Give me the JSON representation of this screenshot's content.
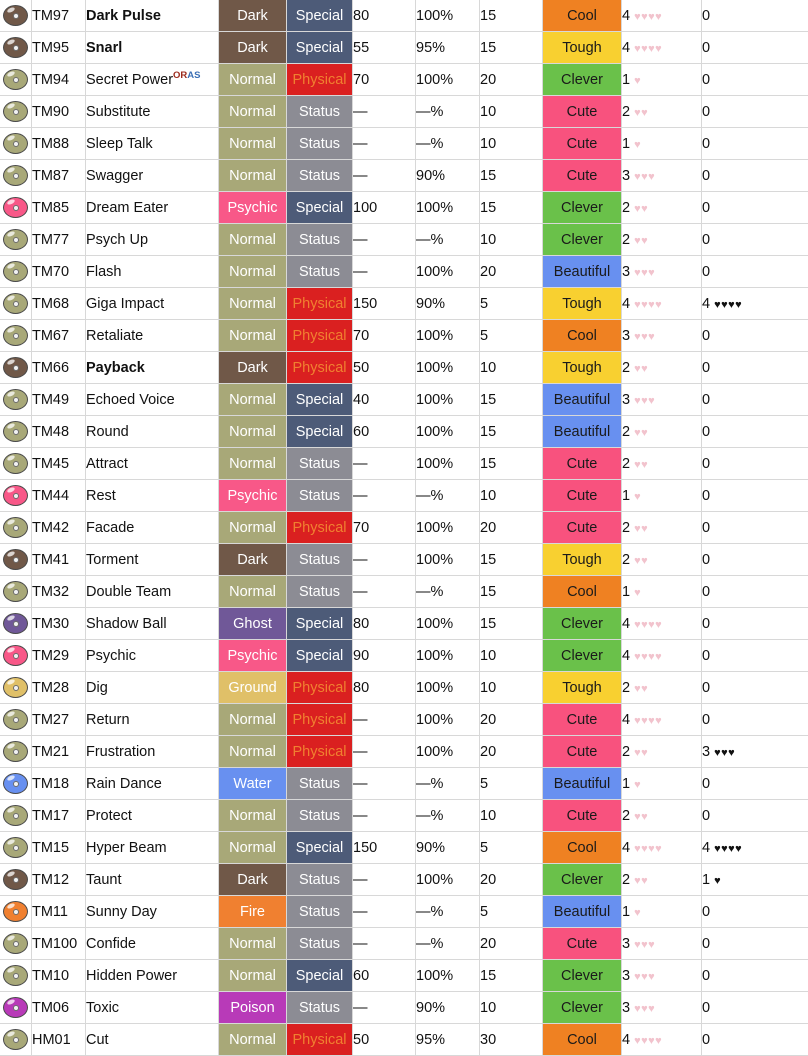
{
  "table": {
    "columns": [
      "icon",
      "number",
      "name",
      "type",
      "category",
      "power",
      "accuracy",
      "pp",
      "contest",
      "appeal",
      "jam"
    ],
    "type_colors": {
      "Dark": "#705848",
      "Normal": "#a8a878",
      "Psychic": "#f85888",
      "Ghost": "#705898",
      "Ground": "#e0c068",
      "Water": "#6890f0",
      "Fire": "#f08030",
      "Poison": "#b83ab8"
    },
    "category_colors": {
      "Physical": "#da2020",
      "Special": "#4d5b78",
      "Status": "#8c8c94"
    },
    "category_text_colors": {
      "Physical": "#f08030",
      "Special": "#ffffff",
      "Status": "#ffffff"
    },
    "contest_colors": {
      "Cool": "#ef8122",
      "Tough": "#f8d030",
      "Clever": "#6ac14a",
      "Cute": "#f8527e",
      "Beautiful": "#6890f0"
    },
    "rows": [
      {
        "number": "TM97",
        "name": "Dark Pulse",
        "bold": true,
        "type": "Dark",
        "category": "Special",
        "power": "80",
        "accuracy": "100%",
        "pp": "15",
        "contest": "Cool",
        "appeal": "4",
        "appeal_hearts": 4,
        "jam": "0",
        "jam_hearts": 0
      },
      {
        "number": "TM95",
        "name": "Snarl",
        "bold": true,
        "type": "Dark",
        "category": "Special",
        "power": "55",
        "accuracy": "95%",
        "pp": "15",
        "contest": "Tough",
        "appeal": "4",
        "appeal_hearts": 4,
        "jam": "0",
        "jam_hearts": 0
      },
      {
        "number": "TM94",
        "name": "Secret Power",
        "bold": false,
        "sup": "ORAS",
        "type": "Normal",
        "category": "Physical",
        "power": "70",
        "accuracy": "100%",
        "pp": "20",
        "contest": "Clever",
        "appeal": "1",
        "appeal_hearts": 1,
        "jam": "0",
        "jam_hearts": 0
      },
      {
        "number": "TM90",
        "name": "Substitute",
        "bold": false,
        "type": "Normal",
        "category": "Status",
        "power": "—",
        "accuracy": "—%",
        "pp": "10",
        "contest": "Cute",
        "appeal": "2",
        "appeal_hearts": 2,
        "jam": "0",
        "jam_hearts": 0
      },
      {
        "number": "TM88",
        "name": "Sleep Talk",
        "bold": false,
        "type": "Normal",
        "category": "Status",
        "power": "—",
        "accuracy": "—%",
        "pp": "10",
        "contest": "Cute",
        "appeal": "1",
        "appeal_hearts": 1,
        "jam": "0",
        "jam_hearts": 0
      },
      {
        "number": "TM87",
        "name": "Swagger",
        "bold": false,
        "type": "Normal",
        "category": "Status",
        "power": "—",
        "accuracy": "90%",
        "pp": "15",
        "contest": "Cute",
        "appeal": "3",
        "appeal_hearts": 3,
        "jam": "0",
        "jam_hearts": 0
      },
      {
        "number": "TM85",
        "name": "Dream Eater",
        "bold": false,
        "type": "Psychic",
        "category": "Special",
        "power": "100",
        "accuracy": "100%",
        "pp": "15",
        "contest": "Clever",
        "appeal": "2",
        "appeal_hearts": 2,
        "jam": "0",
        "jam_hearts": 0
      },
      {
        "number": "TM77",
        "name": "Psych Up",
        "bold": false,
        "type": "Normal",
        "category": "Status",
        "power": "—",
        "accuracy": "—%",
        "pp": "10",
        "contest": "Clever",
        "appeal": "2",
        "appeal_hearts": 2,
        "jam": "0",
        "jam_hearts": 0
      },
      {
        "number": "TM70",
        "name": "Flash",
        "bold": false,
        "type": "Normal",
        "category": "Status",
        "power": "—",
        "accuracy": "100%",
        "pp": "20",
        "contest": "Beautiful",
        "appeal": "3",
        "appeal_hearts": 3,
        "jam": "0",
        "jam_hearts": 0
      },
      {
        "number": "TM68",
        "name": "Giga Impact",
        "bold": false,
        "type": "Normal",
        "category": "Physical",
        "power": "150",
        "accuracy": "90%",
        "pp": "5",
        "contest": "Tough",
        "appeal": "4",
        "appeal_hearts": 4,
        "jam": "4",
        "jam_hearts": 4
      },
      {
        "number": "TM67",
        "name": "Retaliate",
        "bold": false,
        "type": "Normal",
        "category": "Physical",
        "power": "70",
        "accuracy": "100%",
        "pp": "5",
        "contest": "Cool",
        "appeal": "3",
        "appeal_hearts": 3,
        "jam": "0",
        "jam_hearts": 0
      },
      {
        "number": "TM66",
        "name": "Payback",
        "bold": true,
        "type": "Dark",
        "category": "Physical",
        "power": "50",
        "accuracy": "100%",
        "pp": "10",
        "contest": "Tough",
        "appeal": "2",
        "appeal_hearts": 2,
        "jam": "0",
        "jam_hearts": 0
      },
      {
        "number": "TM49",
        "name": "Echoed Voice",
        "bold": false,
        "type": "Normal",
        "category": "Special",
        "power": "40",
        "accuracy": "100%",
        "pp": "15",
        "contest": "Beautiful",
        "appeal": "3",
        "appeal_hearts": 3,
        "jam": "0",
        "jam_hearts": 0
      },
      {
        "number": "TM48",
        "name": "Round",
        "bold": false,
        "type": "Normal",
        "category": "Special",
        "power": "60",
        "accuracy": "100%",
        "pp": "15",
        "contest": "Beautiful",
        "appeal": "2",
        "appeal_hearts": 2,
        "jam": "0",
        "jam_hearts": 0
      },
      {
        "number": "TM45",
        "name": "Attract",
        "bold": false,
        "type": "Normal",
        "category": "Status",
        "power": "—",
        "accuracy": "100%",
        "pp": "15",
        "contest": "Cute",
        "appeal": "2",
        "appeal_hearts": 2,
        "jam": "0",
        "jam_hearts": 0
      },
      {
        "number": "TM44",
        "name": "Rest",
        "bold": false,
        "type": "Psychic",
        "category": "Status",
        "power": "—",
        "accuracy": "—%",
        "pp": "10",
        "contest": "Cute",
        "appeal": "1",
        "appeal_hearts": 1,
        "jam": "0",
        "jam_hearts": 0
      },
      {
        "number": "TM42",
        "name": "Facade",
        "bold": false,
        "type": "Normal",
        "category": "Physical",
        "power": "70",
        "accuracy": "100%",
        "pp": "20",
        "contest": "Cute",
        "appeal": "2",
        "appeal_hearts": 2,
        "jam": "0",
        "jam_hearts": 0
      },
      {
        "number": "TM41",
        "name": "Torment",
        "bold": false,
        "type": "Dark",
        "category": "Status",
        "power": "—",
        "accuracy": "100%",
        "pp": "15",
        "contest": "Tough",
        "appeal": "2",
        "appeal_hearts": 2,
        "jam": "0",
        "jam_hearts": 0
      },
      {
        "number": "TM32",
        "name": "Double Team",
        "bold": false,
        "type": "Normal",
        "category": "Status",
        "power": "—",
        "accuracy": "—%",
        "pp": "15",
        "contest": "Cool",
        "appeal": "1",
        "appeal_hearts": 1,
        "jam": "0",
        "jam_hearts": 0
      },
      {
        "number": "TM30",
        "name": "Shadow Ball",
        "bold": false,
        "type": "Ghost",
        "category": "Special",
        "power": "80",
        "accuracy": "100%",
        "pp": "15",
        "contest": "Clever",
        "appeal": "4",
        "appeal_hearts": 4,
        "jam": "0",
        "jam_hearts": 0
      },
      {
        "number": "TM29",
        "name": "Psychic",
        "bold": false,
        "type": "Psychic",
        "category": "Special",
        "power": "90",
        "accuracy": "100%",
        "pp": "10",
        "contest": "Clever",
        "appeal": "4",
        "appeal_hearts": 4,
        "jam": "0",
        "jam_hearts": 0
      },
      {
        "number": "TM28",
        "name": "Dig",
        "bold": false,
        "type": "Ground",
        "category": "Physical",
        "power": "80",
        "accuracy": "100%",
        "pp": "10",
        "contest": "Tough",
        "appeal": "2",
        "appeal_hearts": 2,
        "jam": "0",
        "jam_hearts": 0
      },
      {
        "number": "TM27",
        "name": "Return",
        "bold": false,
        "type": "Normal",
        "category": "Physical",
        "power": "—",
        "accuracy": "100%",
        "pp": "20",
        "contest": "Cute",
        "appeal": "4",
        "appeal_hearts": 4,
        "jam": "0",
        "jam_hearts": 0
      },
      {
        "number": "TM21",
        "name": "Frustration",
        "bold": false,
        "type": "Normal",
        "category": "Physical",
        "power": "—",
        "accuracy": "100%",
        "pp": "20",
        "contest": "Cute",
        "appeal": "2",
        "appeal_hearts": 2,
        "jam": "3",
        "jam_hearts": 3
      },
      {
        "number": "TM18",
        "name": "Rain Dance",
        "bold": false,
        "type": "Water",
        "category": "Status",
        "power": "—",
        "accuracy": "—%",
        "pp": "5",
        "contest": "Beautiful",
        "appeal": "1",
        "appeal_hearts": 1,
        "jam": "0",
        "jam_hearts": 0
      },
      {
        "number": "TM17",
        "name": "Protect",
        "bold": false,
        "type": "Normal",
        "category": "Status",
        "power": "—",
        "accuracy": "—%",
        "pp": "10",
        "contest": "Cute",
        "appeal": "2",
        "appeal_hearts": 2,
        "jam": "0",
        "jam_hearts": 0
      },
      {
        "number": "TM15",
        "name": "Hyper Beam",
        "bold": false,
        "type": "Normal",
        "category": "Special",
        "power": "150",
        "accuracy": "90%",
        "pp": "5",
        "contest": "Cool",
        "appeal": "4",
        "appeal_hearts": 4,
        "jam": "4",
        "jam_hearts": 4
      },
      {
        "number": "TM12",
        "name": "Taunt",
        "bold": false,
        "type": "Dark",
        "category": "Status",
        "power": "—",
        "accuracy": "100%",
        "pp": "20",
        "contest": "Clever",
        "appeal": "2",
        "appeal_hearts": 2,
        "jam": "1",
        "jam_hearts": 1
      },
      {
        "number": "TM11",
        "name": "Sunny Day",
        "bold": false,
        "type": "Fire",
        "category": "Status",
        "power": "—",
        "accuracy": "—%",
        "pp": "5",
        "contest": "Beautiful",
        "appeal": "1",
        "appeal_hearts": 1,
        "jam": "0",
        "jam_hearts": 0
      },
      {
        "number": "TM100",
        "name": "Confide",
        "bold": false,
        "type": "Normal",
        "category": "Status",
        "power": "—",
        "accuracy": "—%",
        "pp": "20",
        "contest": "Cute",
        "appeal": "3",
        "appeal_hearts": 3,
        "jam": "0",
        "jam_hearts": 0
      },
      {
        "number": "TM10",
        "name": "Hidden Power",
        "bold": false,
        "type": "Normal",
        "category": "Special",
        "power": "60",
        "accuracy": "100%",
        "pp": "15",
        "contest": "Clever",
        "appeal": "3",
        "appeal_hearts": 3,
        "jam": "0",
        "jam_hearts": 0
      },
      {
        "number": "TM06",
        "name": "Toxic",
        "bold": false,
        "type": "Poison",
        "category": "Status",
        "power": "—",
        "accuracy": "90%",
        "pp": "10",
        "contest": "Clever",
        "appeal": "3",
        "appeal_hearts": 3,
        "jam": "0",
        "jam_hearts": 0
      },
      {
        "number": "HM01",
        "name": "Cut",
        "bold": false,
        "type": "Normal",
        "category": "Physical",
        "power": "50",
        "accuracy": "95%",
        "pp": "30",
        "contest": "Cool",
        "appeal": "4",
        "appeal_hearts": 4,
        "jam": "0",
        "jam_hearts": 0
      }
    ]
  }
}
